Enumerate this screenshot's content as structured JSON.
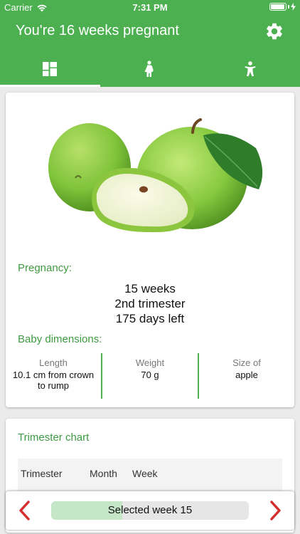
{
  "status_bar": {
    "carrier": "Carrier",
    "time": "7:31 PM",
    "battery_level": 0.95
  },
  "header": {
    "title": "You're 16 weeks pregnant",
    "background_color": "#4caf50",
    "settings_icon": "gear-icon",
    "tabs": [
      {
        "icon": "dashboard-icon",
        "active": true
      },
      {
        "icon": "pregnant-woman-icon",
        "active": false
      },
      {
        "icon": "baby-icon",
        "active": false
      }
    ]
  },
  "main_card": {
    "image": "green-apple",
    "pregnancy_label": "Pregnancy:",
    "pregnancy_lines": [
      "15 weeks",
      "2nd trimester",
      "175 days left"
    ],
    "dimensions_label": "Baby dimensions:",
    "dimensions": [
      {
        "label": "Length",
        "value": "10.1 cm from crown to rump"
      },
      {
        "label": "Weight",
        "value": "70 g"
      },
      {
        "label": "Size of",
        "value": "apple"
      }
    ]
  },
  "trimester_card": {
    "title": "Trimester chart",
    "headers": [
      "Trimester",
      "Month",
      "Week"
    ]
  },
  "week_selector": {
    "label": "Selected week 15",
    "progress": 0.36,
    "accent_color": "#d32f2f"
  }
}
